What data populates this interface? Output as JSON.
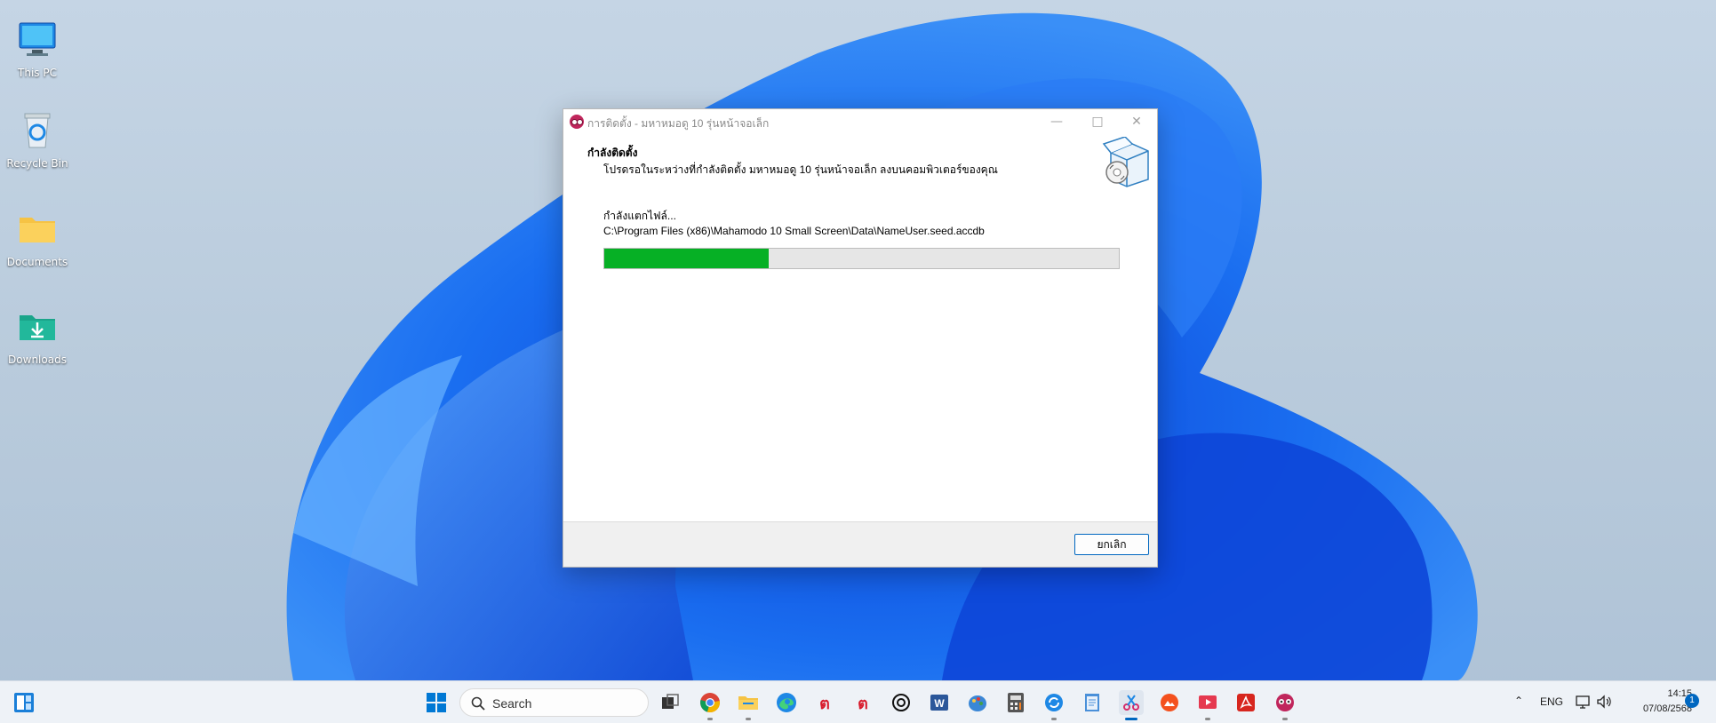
{
  "desktop": {
    "icons": [
      {
        "label": "This PC",
        "icon": "monitor-icon"
      },
      {
        "label": "Recycle Bin",
        "icon": "recycle-bin-icon"
      },
      {
        "label": "Documents",
        "icon": "folder-icon"
      },
      {
        "label": "Downloads",
        "icon": "downloads-folder-icon"
      }
    ]
  },
  "window": {
    "title": "การติดตั้ง - มหาหมอดู 10 รุ่นหน้าจอเล็ก",
    "header_title": "กำลังติดตั้ง",
    "header_subtitle": "โปรดรอในระหว่างที่กำลังติดตั้ง มหาหมอดู 10 รุ่นหน้าจอเล็ก ลงบนคอมพิวเตอร์ของคุณ",
    "status_label": "กำลังแตกไฟล์...",
    "file_path": "C:\\Program Files (x86)\\Mahamodo 10 Small Screen\\Data\\NameUser.seed.accdb",
    "progress_fraction": 0.32,
    "cancel_label": "ยกเลิก",
    "accent_color": "#06b025"
  },
  "taskbar": {
    "search_placeholder": "Search",
    "language": "ENG",
    "time": "14:15",
    "date": "07/08/2568",
    "notification_count": "1",
    "pinned": [
      "windows-start-icon",
      "search-icon",
      "task-view-icon",
      "chrome-icon",
      "file-explorer-icon",
      "edge-icon",
      "thai-app-icon",
      "thai-app-2-icon",
      "chatgpt-icon",
      "word-icon",
      "paint-icon",
      "calculator-icon",
      "sync-icon",
      "notepad-icon",
      "snipping-tool-icon",
      "photo-app-icon",
      "media-app-icon",
      "acrobat-icon",
      "mahamodo-icon"
    ]
  }
}
